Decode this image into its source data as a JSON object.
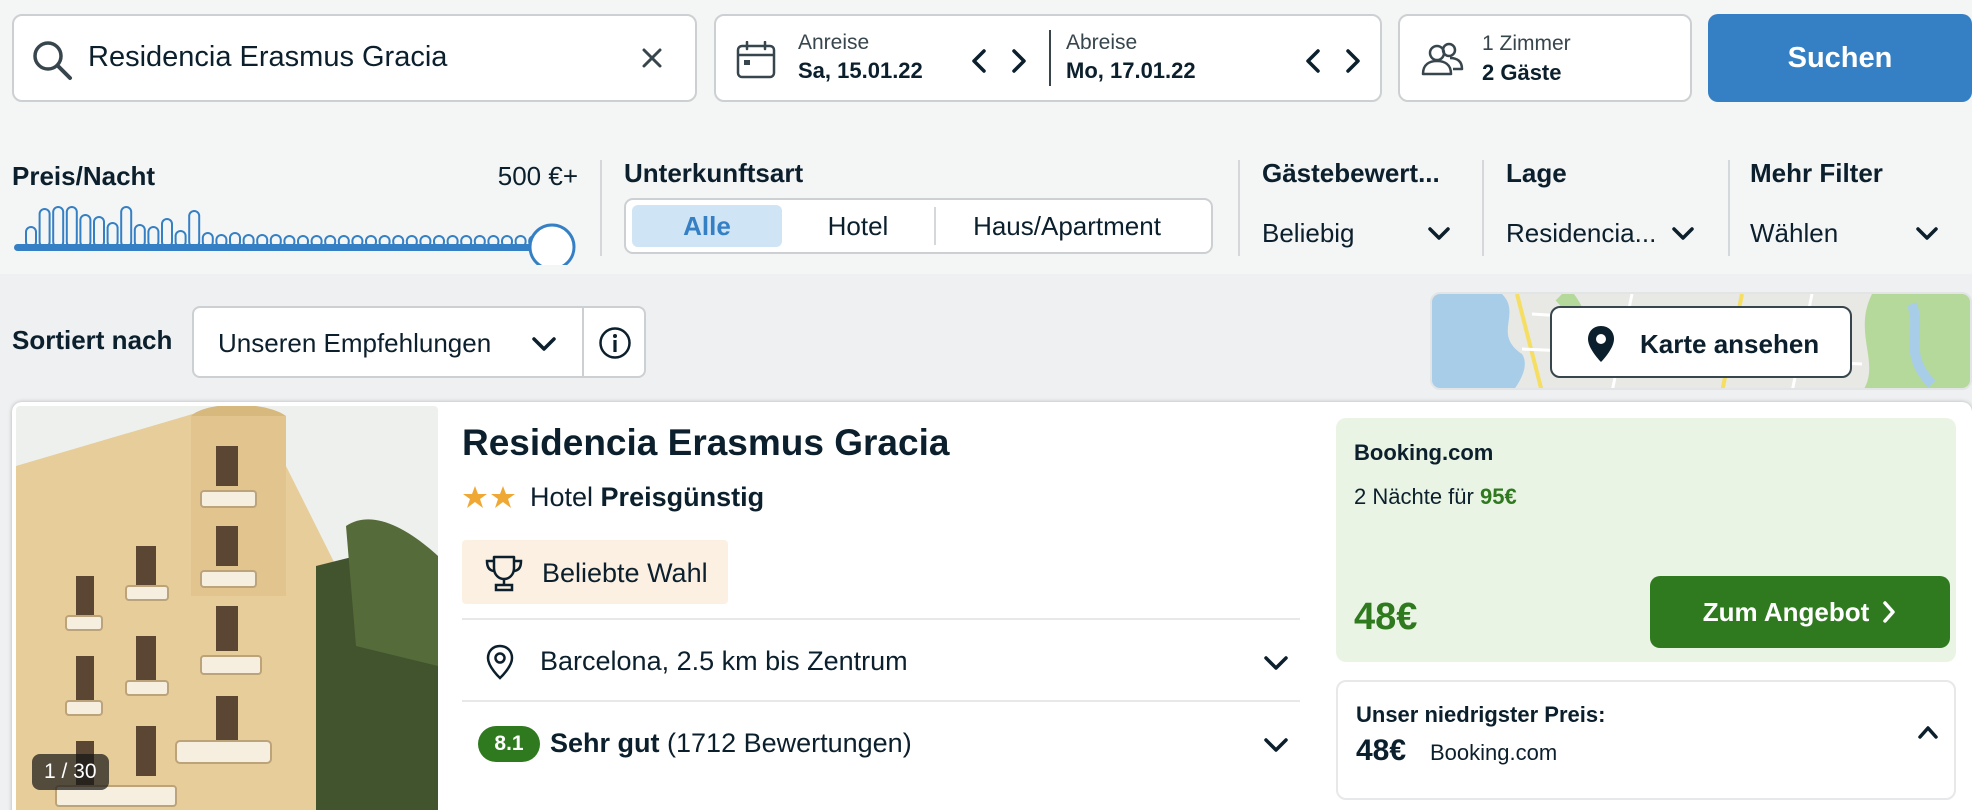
{
  "search": {
    "query": "Residencia Erasmus Gracia"
  },
  "dates": {
    "checkin_label": "Anreise",
    "checkin_value": "Sa, 15.01.22",
    "checkout_label": "Abreise",
    "checkout_value": "Mo, 17.01.22"
  },
  "guests": {
    "rooms": "1 Zimmer",
    "guests": "2 Gäste"
  },
  "search_button": "Suchen",
  "filters": {
    "price": {
      "title": "Preis/Nacht",
      "value": "500 €+",
      "slider_fraction": 1.0
    },
    "type": {
      "title": "Unterkunftsart",
      "options": [
        "Alle",
        "Hotel",
        "Haus/Apartment"
      ],
      "active": "Alle"
    },
    "rating": {
      "title": "Gästebewert...",
      "value": "Beliebig"
    },
    "location": {
      "title": "Lage",
      "value": "Residencia..."
    },
    "more": {
      "title": "Mehr Filter",
      "value": "Wählen"
    }
  },
  "sort": {
    "label": "Sortiert nach",
    "value": "Unseren Empfehlungen"
  },
  "map": {
    "button_label": "Karte ansehen"
  },
  "hotel": {
    "photo_counter": "1 / 30",
    "name": "Residencia Erasmus Gracia",
    "stars": 2,
    "type": "Hotel",
    "price_class": "Preisgünstig",
    "badge": "Beliebte Wahl",
    "location": "Barcelona, 2.5 km bis Zentrum",
    "rating_score": "8.1",
    "rating_word": "Sehr gut",
    "rating_count": "(1712 Bewertungen)",
    "offer": {
      "provider": "Booking.com",
      "nights_text": "2 Nächte für",
      "nights_price": "95€",
      "price": "48€",
      "button": "Zum Angebot"
    },
    "lowest": {
      "label": "Unser niedrigster Preis:",
      "price": "48€",
      "provider": "Booking.com"
    }
  },
  "colors": {
    "brand_blue": "#3580c4",
    "deal_green": "#2f7a1f",
    "text_dark": "#0b1f2c"
  }
}
